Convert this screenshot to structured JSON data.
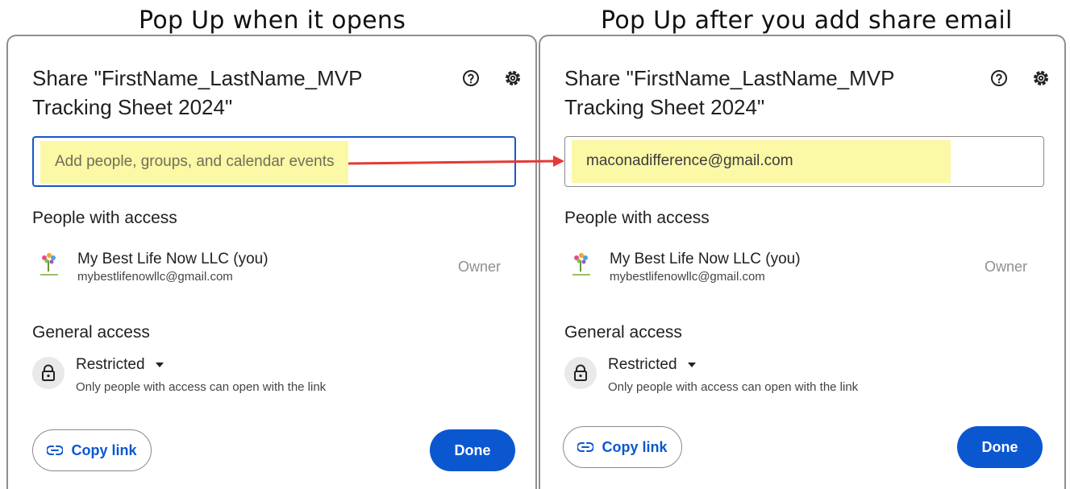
{
  "captions": {
    "left": "Pop Up when it opens",
    "right": "Pop Up after you add share email"
  },
  "dialog_left": {
    "title": "Share \"FirstName_LastName_MVP Tracking Sheet 2024\"",
    "input_placeholder": "Add people, groups, and calendar events",
    "people_heading": "People with access",
    "person_name": "My Best Life Now LLC (you)",
    "person_email": "mybestlifenowllc@gmail.com",
    "person_role": "Owner",
    "general_heading": "General access",
    "access_level": "Restricted",
    "access_description": "Only people with access can open with the link",
    "copy_link_label": "Copy link",
    "done_label": "Done"
  },
  "dialog_right": {
    "title": "Share \"FirstName_LastName_MVP Tracking Sheet 2024\"",
    "input_value": "maconadifference@gmail.com",
    "people_heading": "People with access",
    "person_name": "My Best Life Now LLC (you)",
    "person_email": "mybestlifenowllc@gmail.com",
    "person_role": "Owner",
    "general_heading": "General access",
    "access_level": "Restricted",
    "access_description": "Only people with access can open with the link",
    "copy_link_label": "Copy link",
    "done_label": "Done"
  },
  "icons": {
    "help": "help-circle-icon",
    "settings": "gear-icon",
    "lock": "lock-icon",
    "link": "link-icon",
    "dropdown": "caret-down-icon",
    "arrow": "red-arrow-icon"
  },
  "colors": {
    "accent_blue": "#0b57d0",
    "highlight_yellow": "#fbf8a6",
    "arrow_red": "#e53935"
  }
}
